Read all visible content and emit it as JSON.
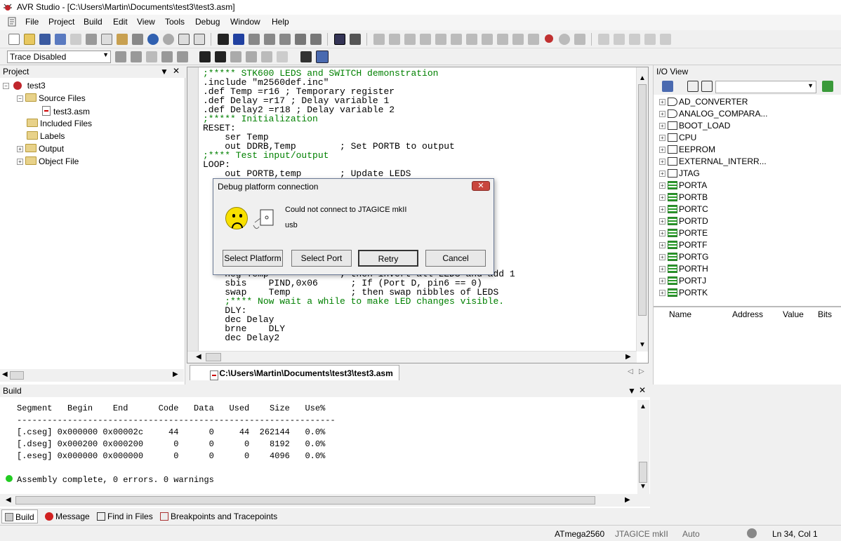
{
  "window": {
    "title": "AVR Studio - [C:\\Users\\Martin\\Documents\\test3\\test3.asm]"
  },
  "menu": [
    {
      "label": "File",
      "u": "F"
    },
    {
      "label": "Project",
      "u": "P"
    },
    {
      "label": "Build",
      "u": "B"
    },
    {
      "label": "Edit",
      "u": "E"
    },
    {
      "label": "View",
      "u": "V"
    },
    {
      "label": "Tools",
      "u": "T"
    },
    {
      "label": "Debug",
      "u": "D"
    },
    {
      "label": "Window",
      "u": "W"
    },
    {
      "label": "Help",
      "u": "H"
    }
  ],
  "toolbar2": {
    "trace_select_value": "Trace Disabled"
  },
  "project": {
    "header": "Project",
    "root": "test3",
    "items": [
      "Source Files",
      "test3.asm",
      "Included Files",
      "Labels",
      "Output",
      "Object File"
    ]
  },
  "editor": {
    "tab_label": "C:\\Users\\Martin\\Documents\\test3\\test3.asm",
    "lines": [
      {
        "t": ";***** STK600 LEDS and SWITCH demonstration",
        "c": "cm"
      },
      {
        "t": ".include \"m2560def.inc\"",
        "c": ""
      },
      {
        "t": ".def Temp =r16 ; Temporary register",
        "c": ""
      },
      {
        "t": ".def Delay =r17 ; Delay variable 1",
        "c": ""
      },
      {
        "t": ".def Delay2 =r18 ; Delay variable 2",
        "c": ""
      },
      {
        "t": ";***** Initialization",
        "c": "cm"
      },
      {
        "t": "RESET:",
        "c": ""
      },
      {
        "t": "    ser Temp",
        "c": ""
      },
      {
        "t": "    out DDRB,Temp        ; Set PORTB to output",
        "c": ""
      },
      {
        "t": ";**** Test input/output",
        "c": "cm"
      },
      {
        "t": "LOOP:",
        "c": ""
      },
      {
        "t": "    out PORTB,temp       ; Update LEDS",
        "c": ""
      },
      {
        "t": "",
        "c": ""
      },
      {
        "t": "",
        "c": ""
      },
      {
        "t": "",
        "c": ""
      },
      {
        "t": "",
        "c": ""
      },
      {
        "t": "",
        "c": ""
      },
      {
        "t": "",
        "c": ""
      },
      {
        "t": "",
        "c": ""
      },
      {
        "t": "",
        "c": ""
      },
      {
        "t": "",
        "c": ""
      },
      {
        "t": "",
        "c": ""
      },
      {
        "t": "    neg Temp             ; then invert all LEDS and add 1",
        "c": ""
      },
      {
        "t": "    sbis    PIND,0x06      ; If (Port D, pin6 == 0)",
        "c": ""
      },
      {
        "t": "    swap    Temp           ; then swap nibbles of LEDS",
        "c": ""
      },
      {
        "t": "    ;**** Now wait a while to make LED changes visible.",
        "c": "cm"
      },
      {
        "t": "    DLY:",
        "c": ""
      },
      {
        "t": "    dec Delay",
        "c": ""
      },
      {
        "t": "    brne    DLY",
        "c": ""
      },
      {
        "t": "    dec Delay2",
        "c": ""
      }
    ]
  },
  "io": {
    "header": "I/O View",
    "items": [
      {
        "label": "AD_CONVERTER",
        "icon": "d"
      },
      {
        "label": "ANALOG_COMPARA...",
        "icon": "d"
      },
      {
        "label": "BOOT_LOAD",
        "icon": "box"
      },
      {
        "label": "CPU",
        "icon": "box"
      },
      {
        "label": "EEPROM",
        "icon": "box"
      },
      {
        "label": "EXTERNAL_INTERR...",
        "icon": "box"
      },
      {
        "label": "JTAG",
        "icon": "box"
      },
      {
        "label": "PORTA",
        "icon": "port"
      },
      {
        "label": "PORTB",
        "icon": "port"
      },
      {
        "label": "PORTC",
        "icon": "port"
      },
      {
        "label": "PORTD",
        "icon": "port"
      },
      {
        "label": "PORTE",
        "icon": "port"
      },
      {
        "label": "PORTF",
        "icon": "port"
      },
      {
        "label": "PORTG",
        "icon": "port"
      },
      {
        "label": "PORTH",
        "icon": "port"
      },
      {
        "label": "PORTJ",
        "icon": "port"
      },
      {
        "label": "PORTK",
        "icon": "port"
      }
    ],
    "columns": [
      "Name",
      "Address",
      "Value",
      "Bits"
    ]
  },
  "build": {
    "header": "Build",
    "lines": [
      "Segment   Begin    End      Code   Data   Used    Size   Use%",
      "---------------------------------------------------------------",
      "[.cseg] 0x000000 0x00002c     44      0     44  262144   0.0%",
      "[.dseg] 0x000200 0x000200      0      0      0    8192   0.0%",
      "[.eseg] 0x000000 0x000000      0      0      0    4096   0.0%",
      "",
      "Assembly complete, 0 errors. 0 warnings"
    ],
    "tabs": [
      "Build",
      "Message",
      "Find in Files",
      "Breakpoints and Tracepoints"
    ]
  },
  "status": {
    "device": "ATmega2560",
    "tool": "JTAGICE mkII",
    "mode": "Auto",
    "position": "Ln 34, Col 1"
  },
  "dialog": {
    "title": "Debug platform connection",
    "message": "Could not connect to JTAGICE mkII",
    "sub": "usb",
    "buttons": [
      "Select Platform",
      "Select Port",
      "Retry",
      "Cancel"
    ],
    "close": "✕"
  }
}
